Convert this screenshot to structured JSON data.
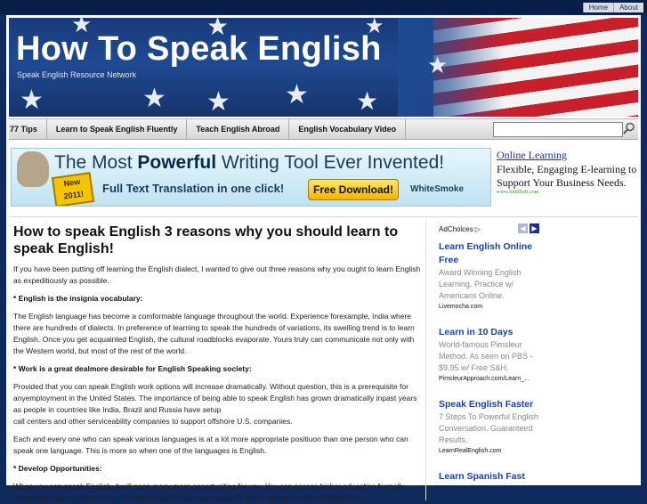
{
  "top_links": [
    "Home",
    "About"
  ],
  "header": {
    "title": "How To Speak English",
    "subtitle": "Speak English Resource Network"
  },
  "nav": {
    "items": [
      "77 Tips",
      "Learn to Speak English Fluently",
      "Teach English Abroad",
      "English Vocabulary Video"
    ],
    "search_placeholder": ""
  },
  "banner": {
    "headline_pre": "The Most ",
    "headline_bold": "Powerful",
    "headline_post": " Writing Tool Ever Invented!",
    "badge": "New 2011!",
    "sub": "Full Text Translation in one click!",
    "button": "Free Download!",
    "brand": "WhiteSmoke"
  },
  "side_ad": {
    "title": "Online Learning",
    "desc": "Flexible, Engaging E-learning to Support Your Business Needs.",
    "url": "www.SkillSoft.com"
  },
  "article": {
    "title": "How to speak English 3 reasons why you should learn to speak English!",
    "intro": "If you have been putting off learning the English dialect, I wanted to give out three reasons why you ought to learn English as expeditiously as possible.",
    "h1": "* English is the insignia vocabulary:",
    "p1": "The English language has become a comformable language throughout the world. Experience forexample, India where there are hundreds of dialects. In preference of learning to speak the hundreds of variations, its swelling trend is to learn English. Once you get acquainted English, the cultural roadblocks evaporate. Yours truly can communicate not only with the Western world, but most of the rest of the world.",
    "h2": "* Work is a great dealmore desirable for English Speaking society:",
    "p2a": "Provided that you can speak English work options will increase dramatically. Without question, this is a prerequisite for anyemployment in the United States. The importance of being able to speak English has grown dramatically inpast years as people in countries like India, Brazil and Russia have setup",
    "p2b": "call centers and other serviceability companies to support offshore U.S. companies.",
    "p3": "Each and every one who can speak various languages is at a lot more appropriate positiuon than one person who can speak one language. This is more so when one of the languages is English.",
    "h3": "* Develop Opportunities:",
    "p4": "When you can speak English, it will open many more opportunities for you. You can access higher education formally obtainable only for Westerners. You will be able to take advantage of travel agencies andundoubtedly the"
  },
  "ads": {
    "adchoices": "AdChoices",
    "items": [
      {
        "title": "Learn English Online Free",
        "desc": "Award Winning English Learning. Practice w/ Americans Online.",
        "url": "Livemocha.com"
      },
      {
        "title": "Learn in 10 Days",
        "desc": "World-famous Pimsleur Method. As seen on PBS - $9.95 w/ Free S&H.",
        "url": "PimsleurApproach.com/Learn_..."
      },
      {
        "title": "Speak English Faster",
        "desc": "7 Steps To Powerful English Conversation. Guaranteed Results.",
        "url": "LearnRealEnglish.com"
      },
      {
        "title": "Learn Spanish Fast",
        "desc": "",
        "url": ""
      }
    ]
  }
}
